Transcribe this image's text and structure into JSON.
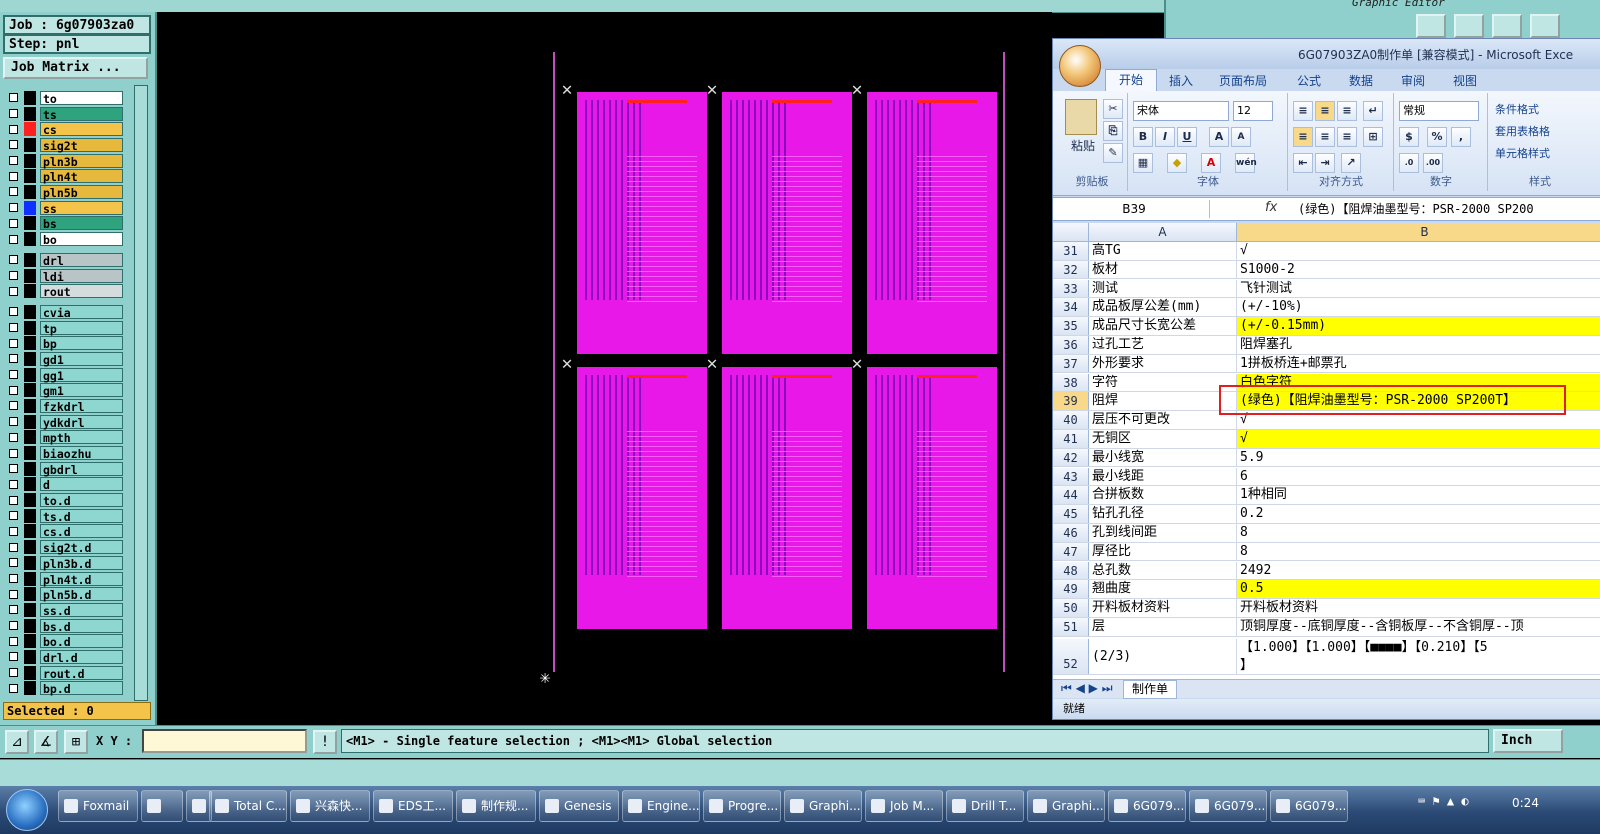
{
  "genesis": {
    "job_label": "Job : 6g07903za0",
    "step_label": "Step: pnl",
    "job_matrix_button": "Job Matrix ...",
    "selected_label": "Selected : 0",
    "xy_label": "X Y :",
    "status_message": "<M1> - Single feature selection ; <M1><M1> Global selection",
    "unit_button": "Inch",
    "top_right_caption": "Graphic Editor",
    "layers_group1": [
      {
        "name": "to",
        "swatch": "#000000",
        "bg": "#ffffff"
      },
      {
        "name": "ts",
        "swatch": "#000000",
        "bg": "#2ea37e"
      },
      {
        "name": "cs",
        "swatch": "#ff2020",
        "bg": "#f3c34a"
      },
      {
        "name": "sig2t",
        "swatch": "#000000",
        "bg": "#e6b93c"
      },
      {
        "name": "pln3b",
        "swatch": "#000000",
        "bg": "#e6b93c"
      },
      {
        "name": "pln4t",
        "swatch": "#000000",
        "bg": "#e6b93c"
      },
      {
        "name": "pln5b",
        "swatch": "#000000",
        "bg": "#e6b93c"
      },
      {
        "name": "ss",
        "swatch": "#1030ff",
        "bg": "#f3c34a"
      },
      {
        "name": "bs",
        "swatch": "#000000",
        "bg": "#2ea37e"
      },
      {
        "name": "bo",
        "swatch": "#000000",
        "bg": "#ffffff"
      }
    ],
    "layers_group2": [
      {
        "name": "drl",
        "swatch": "#000000",
        "bg": "#b9c4c6"
      },
      {
        "name": "ldi",
        "swatch": "#000000",
        "bg": "#b9c4c6"
      },
      {
        "name": "rout",
        "swatch": "#000000",
        "bg": "#d5dcdd"
      }
    ],
    "layers_group3": [
      {
        "name": "cvia"
      },
      {
        "name": "tp"
      },
      {
        "name": "bp"
      },
      {
        "name": "gd1"
      },
      {
        "name": "gg1"
      },
      {
        "name": "gm1"
      },
      {
        "name": "fzkdrl"
      },
      {
        "name": "ydkdrl"
      },
      {
        "name": "mpth"
      },
      {
        "name": "biaozhu"
      },
      {
        "name": "gbdrl"
      },
      {
        "name": "d"
      },
      {
        "name": "to.d"
      },
      {
        "name": "ts.d"
      },
      {
        "name": "cs.d"
      },
      {
        "name": "sig2t.d"
      },
      {
        "name": "pln3b.d"
      },
      {
        "name": "pln4t.d"
      },
      {
        "name": "pln5b.d"
      },
      {
        "name": "ss.d"
      },
      {
        "name": "bs.d"
      },
      {
        "name": "bo.d"
      },
      {
        "name": "drl.d"
      },
      {
        "name": "rout.d"
      },
      {
        "name": "bp.d"
      }
    ]
  },
  "excel": {
    "title": "6G07903ZA0制作单 [兼容模式] - Microsoft Exce",
    "tabs": [
      "开始",
      "插入",
      "页面布局",
      "公式",
      "数据",
      "审阅",
      "视图"
    ],
    "ribbon": {
      "paste": "粘贴",
      "clipboard": "剪贴板",
      "font_name": "宋体",
      "font_size": "12",
      "font_group": "字体",
      "align_group": "对齐方式",
      "number_format": "常规",
      "number_group": "数字",
      "style_group": "样式",
      "cond_format": "条件格式",
      "table_format": "套用表格格",
      "cell_style": "单元格样式"
    },
    "name_box": "B39",
    "formula": "(绿色)【阻焊油墨型号：PSR-2000 SP200",
    "col_a": "A",
    "col_b": "B",
    "rows": [
      {
        "n": "31",
        "a": "高TG",
        "b": "√",
        "hl": false
      },
      {
        "n": "32",
        "a": "板材",
        "b": "S1000-2",
        "hl": false
      },
      {
        "n": "33",
        "a": "测试",
        "b": "飞针测试",
        "hl": false
      },
      {
        "n": "34",
        "a": "成品板厚公差(mm)",
        "b": "(+/-10%)",
        "hl": false
      },
      {
        "n": "35",
        "a": "成品尺寸长宽公差",
        "b": "(+/-0.15mm)",
        "hl": true
      },
      {
        "n": "36",
        "a": "过孔工艺",
        "b": "阻焊塞孔",
        "hl": false
      },
      {
        "n": "37",
        "a": "外形要求",
        "b": "1拼板桥连+邮票孔",
        "hl": false
      },
      {
        "n": "38",
        "a": "字符",
        "b": "白色字符",
        "hl": true
      },
      {
        "n": "39",
        "a": "阻焊",
        "b": "(绿色)【阻焊油墨型号：PSR-2000 SP200T】",
        "hl": true
      },
      {
        "n": "40",
        "a": "层压不可更改",
        "b": "√",
        "hl": false
      },
      {
        "n": "41",
        "a": "无铜区",
        "b": "√",
        "hl": true
      },
      {
        "n": "42",
        "a": "最小线宽",
        "b": "5.9",
        "hl": false
      },
      {
        "n": "43",
        "a": "最小线距",
        "b": "6",
        "hl": false
      },
      {
        "n": "44",
        "a": "合拼板数",
        "b": "1种相同",
        "hl": false
      },
      {
        "n": "45",
        "a": "钻孔孔径",
        "b": "0.2",
        "hl": false
      },
      {
        "n": "46",
        "a": "孔到线间距",
        "b": "8",
        "hl": false
      },
      {
        "n": "47",
        "a": "厚径比",
        "b": "8",
        "hl": false
      },
      {
        "n": "48",
        "a": "总孔数",
        "b": "2492",
        "hl": false
      },
      {
        "n": "49",
        "a": "翘曲度",
        "b": "0.5",
        "hl": true
      },
      {
        "n": "50",
        "a": "开料板材资料",
        "b": "开料板材资料",
        "hl": false
      },
      {
        "n": "51",
        "a": "层",
        "b": "顶铜厚度--底铜厚度--含铜板厚--不含铜厚--顶",
        "hl": false
      }
    ],
    "row52_n": "52",
    "row52_a": "(2/3)",
    "row52_b": "【1.000】【1.000】【■■■■】【0.210】【5",
    "row52_b2": "】",
    "sheet_tab": "制作单",
    "status": "就绪"
  },
  "taskbar": {
    "items": [
      "Foxmail",
      "",
      "",
      "Total C...",
      "兴森快...",
      "EDS工...",
      "制作规...",
      "Genesis",
      "Engine...",
      "Progre...",
      "Graphi...",
      "Job M...",
      "Drill T...",
      "Graphi...",
      "6G079...",
      "6G079...",
      "6G079..."
    ],
    "clock": "0:24"
  }
}
